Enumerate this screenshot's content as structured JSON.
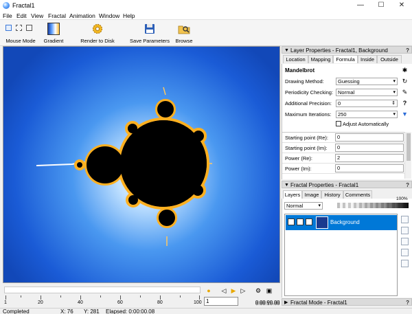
{
  "window": {
    "title": "Fractal1",
    "min": "—",
    "max": "☐",
    "close": "✕"
  },
  "menu": [
    "File",
    "Edit",
    "View",
    "Fractal",
    "Animation",
    "Window",
    "Help"
  ],
  "toolbar": {
    "mouse_mode": "Mouse Mode",
    "gradient": "Gradient",
    "render": "Render to Disk",
    "save": "Save Parameters",
    "browse": "Browse"
  },
  "layer_panel": {
    "title": "Layer Properties - Fractal1, Background",
    "tabs": [
      "Location",
      "Mapping",
      "Formula",
      "Inside",
      "Outside"
    ],
    "active_tab": "Formula",
    "formula_name": "Mandelbrot",
    "drawing_method": {
      "label": "Drawing Method:",
      "value": "Guessing"
    },
    "periodicity": {
      "label": "Periodicity Checking:",
      "value": "Normal"
    },
    "precision": {
      "label": "Additional Precision:",
      "value": "0"
    },
    "max_iter": {
      "label": "Maximum Iterations:",
      "value": "250"
    },
    "adjust_auto": "Adjust Automatically",
    "params": [
      {
        "label": "Starting point (Re):",
        "value": "0"
      },
      {
        "label": "Starting point (Im):",
        "value": "0"
      },
      {
        "label": "Power (Re):",
        "value": "2"
      },
      {
        "label": "Power (Im):",
        "value": "0"
      }
    ]
  },
  "fractal_panel": {
    "title": "Fractal Properties - Fractal1",
    "tabs": [
      "Layers",
      "Image",
      "History",
      "Comments"
    ],
    "active_tab": "Layers",
    "blend_mode": "Normal",
    "opacity": "100%",
    "opacity_fraction": 1.0,
    "layer_name": "Background"
  },
  "fractal_mode": {
    "title": "Fractal Mode - Fractal1"
  },
  "timeline": {
    "ticks": [
      "1",
      "20",
      "40",
      "60",
      "80",
      "100"
    ],
    "frame": "1",
    "time_top": "0:00:00.00",
    "time_bottom": "0:00:10.00"
  },
  "status": {
    "state": "Completed",
    "x": "X: 76",
    "y": "Y: 281",
    "elapsed": "Elapsed: 0:00:00.08"
  },
  "colors": {
    "selection": "#0078d7",
    "canvas_deep": "#1248b8",
    "set": "#000000",
    "edge": "#ffb020"
  }
}
